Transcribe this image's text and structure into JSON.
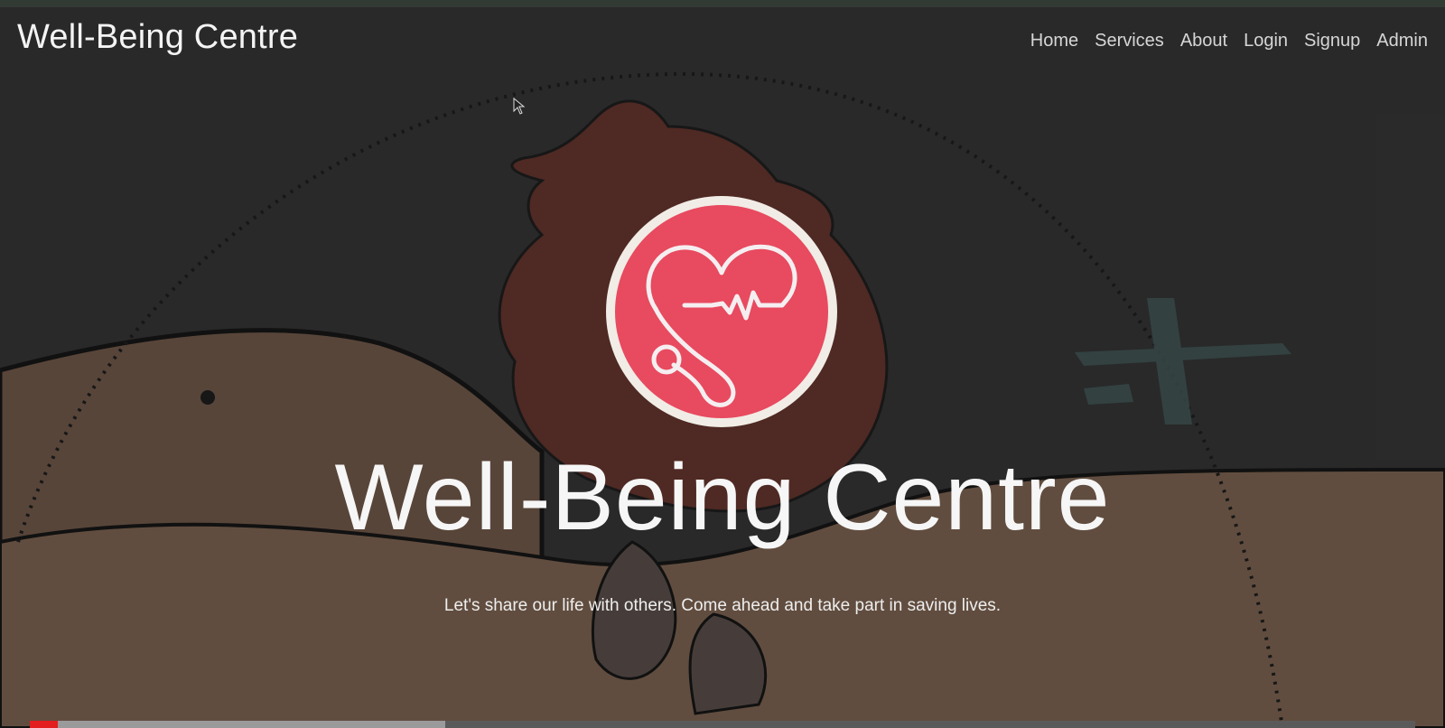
{
  "navbar": {
    "brand": "Well-Being Centre",
    "links": [
      {
        "label": "Home"
      },
      {
        "label": "Services"
      },
      {
        "label": "About"
      },
      {
        "label": "Login"
      },
      {
        "label": "Signup"
      },
      {
        "label": "Admin"
      }
    ]
  },
  "hero": {
    "logo_icon": "heart-stethoscope-icon",
    "title": "Well-Being Centre",
    "subtitle": "Let's share our life with others. Come ahead and take part in saving lives."
  },
  "video": {
    "played_fraction": 0.02,
    "buffered_fraction": 0.3
  },
  "colors": {
    "logo_red": "#e84a5f",
    "logo_ring": "#f1ece6"
  }
}
